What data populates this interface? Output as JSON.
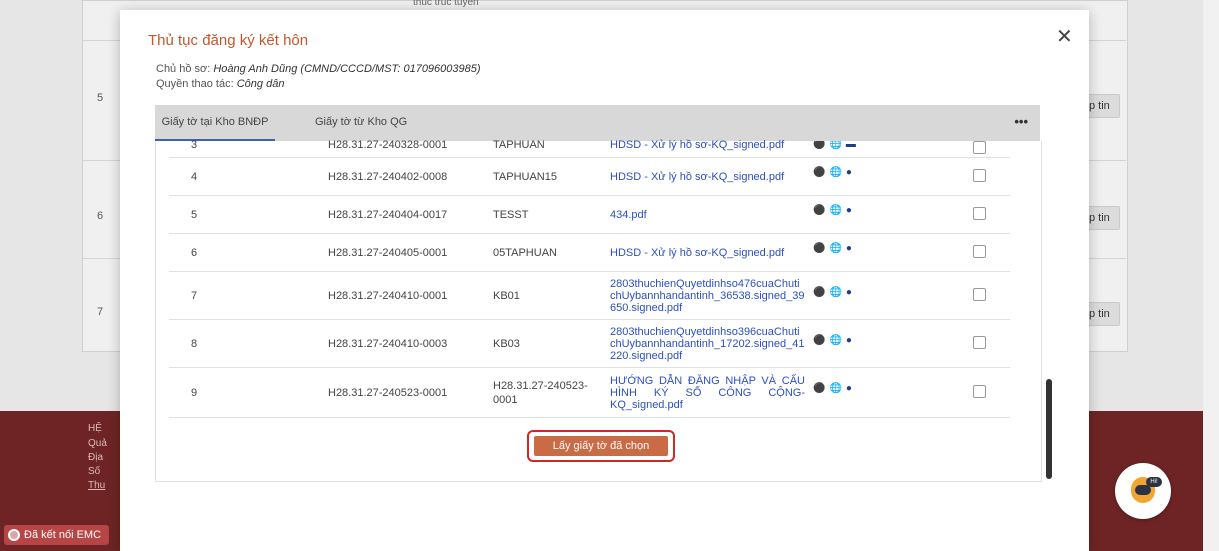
{
  "background": {
    "rows": [
      "5",
      "6",
      "7"
    ],
    "row_button_label": "p tin",
    "top_fragment": "thuc truc tuyen",
    "footer_lines": [
      "HỆ",
      "Quả",
      "Địa",
      "Số",
      "Thu"
    ],
    "emc_label": "Đã kết nối EMC",
    "chatbot_badge": "Hi!"
  },
  "modal": {
    "title": "Thủ tục đăng ký kết hôn",
    "owner_label": "Chủ hồ sơ:",
    "owner_value": "Hoàng Anh Dũng (CMND/CCCD/MST: 017096003985)",
    "permission_label": "Quyền thao tác:",
    "permission_value": "Công dân",
    "close_symbol": "✕",
    "tabs": [
      "Giấy tờ tại Kho BNĐP",
      "Giấy tờ từ Kho QG"
    ],
    "more_symbol": "•••",
    "rows": [
      {
        "stt": "3",
        "code": "H28.31.27-240328-0001",
        "name": "TAPHUAN",
        "file": "HDSD - Xử lý hồ sơ-KQ_signed.pdf"
      },
      {
        "stt": "4",
        "code": "H28.31.27-240402-0008",
        "name": "TAPHUAN15",
        "file": "HDSD - Xử lý hồ sơ-KQ_signed.pdf"
      },
      {
        "stt": "5",
        "code": "H28.31.27-240404-0017",
        "name": "TESST",
        "file": "434.pdf"
      },
      {
        "stt": "6",
        "code": "H28.31.27-240405-0001",
        "name": "05TAPHUAN",
        "file": "HDSD - Xử lý hồ sơ-KQ_signed.pdf"
      },
      {
        "stt": "7",
        "code": "H28.31.27-240410-0001",
        "name": "KB01",
        "file": "2803thuchienQuyetdinhso476cuaChutichUybannhandantinh_36538.signed_39650.signed.pdf"
      },
      {
        "stt": "8",
        "code": "H28.31.27-240410-0003",
        "name": "KB03",
        "file": "2803thuchienQuyetdinhso396cuaChutichUybannhandantinh_17202.signed_41220.signed.pdf"
      },
      {
        "stt": "9",
        "code": "H28.31.27-240523-0001",
        "name": "H28.31.27-240523-0001",
        "file": "HƯỚNG DẪN ĐĂNG NHẬP VÀ CẤU HÌNH KÝ SỐ CÔNG CỘNG-KQ_signed.pdf"
      }
    ],
    "get_button_label": "Lấy giấy tờ đã chọn"
  }
}
